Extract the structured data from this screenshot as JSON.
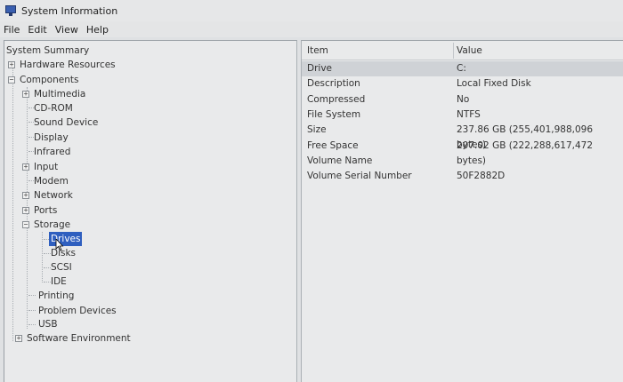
{
  "window": {
    "title": "System Information"
  },
  "menu": {
    "file": "File",
    "edit": "Edit",
    "view": "View",
    "help": "Help"
  },
  "tree": {
    "system_summary": "System Summary",
    "hardware_resources": "Hardware Resources",
    "components": "Components",
    "multimedia": "Multimedia",
    "cd_rom": "CD-ROM",
    "sound_device": "Sound Device",
    "display": "Display",
    "infrared": "Infrared",
    "input": "Input",
    "modem": "Modem",
    "network": "Network",
    "ports": "Ports",
    "storage": "Storage",
    "drives": "Drives",
    "disks": "Disks",
    "scsi": "SCSI",
    "ide": "IDE",
    "printing": "Printing",
    "problem_devices": "Problem Devices",
    "usb": "USB",
    "software_environment": "Software Environment",
    "expand_symbol": "+",
    "collapse_symbol": "−"
  },
  "details": {
    "columns": {
      "item": "Item",
      "value": "Value"
    },
    "rows": [
      {
        "item": "Drive",
        "value": "C:"
      },
      {
        "item": "Description",
        "value": "Local Fixed Disk"
      },
      {
        "item": "Compressed",
        "value": "No"
      },
      {
        "item": "File System",
        "value": "NTFS"
      },
      {
        "item": "Size",
        "value": "237.86 GB (255,401,988,096 bytes)"
      },
      {
        "item": "Free Space",
        "value": "207.02 GB (222,288,617,472 bytes)"
      },
      {
        "item": "Volume Name",
        "value": ""
      },
      {
        "item": "Volume Serial Number",
        "value": "50F2882D"
      }
    ]
  },
  "colors": {
    "selection": "#2f5fbf",
    "row_highlight": "#cfd2d6",
    "background": "#e9eaeb"
  }
}
